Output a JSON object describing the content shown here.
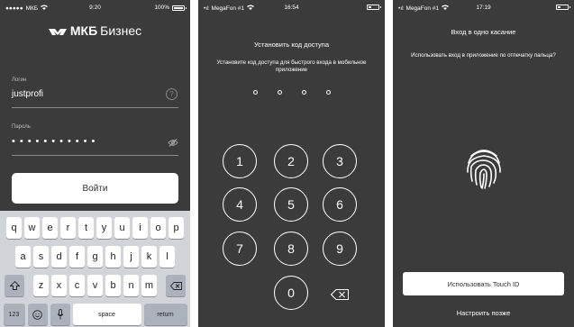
{
  "login_screen": {
    "status": {
      "carrier": "МКБ",
      "time": "9:20",
      "battery": "100%",
      "battery_level": 1.0
    },
    "logo": {
      "bold": "МКБ",
      "light": "Бизнес"
    },
    "login_label": "Логин",
    "login_value": "justprofi",
    "password_label": "Пароль",
    "password_dots": "•••••••••••",
    "login_button": "Войти",
    "keyboard": {
      "row1": [
        "q",
        "w",
        "e",
        "r",
        "t",
        "y",
        "u",
        "i",
        "o",
        "p"
      ],
      "row2": [
        "a",
        "s",
        "d",
        "f",
        "g",
        "h",
        "j",
        "k",
        "l"
      ],
      "row3": [
        "z",
        "x",
        "c",
        "v",
        "b",
        "n",
        "m"
      ],
      "numbers_key": "123",
      "space_key": "space",
      "return_key": "return"
    }
  },
  "pin_screen": {
    "status": {
      "carrier": "MegaFon #1",
      "time": "16:54",
      "battery_level": 0.3
    },
    "title": "Установить код доступа",
    "subtitle": "Установите код доступа для быстрого входа в мобильное приложение",
    "digits": [
      "1",
      "2",
      "3",
      "4",
      "5",
      "6",
      "7",
      "8",
      "9",
      "0"
    ]
  },
  "touchid_screen": {
    "status": {
      "carrier": "MegaFon #1",
      "time": "17:19",
      "battery_level": 0.3
    },
    "title": "Вход в одно касание",
    "subtitle": "Использовать вход в приложение по отпечатку пальца?",
    "use_button": "Использовать Touch ID",
    "later_link": "Настроить позже"
  },
  "colors": {
    "background": "#3b3b3b",
    "keyboard": "#d1d4d9",
    "button": "#ffffff"
  }
}
